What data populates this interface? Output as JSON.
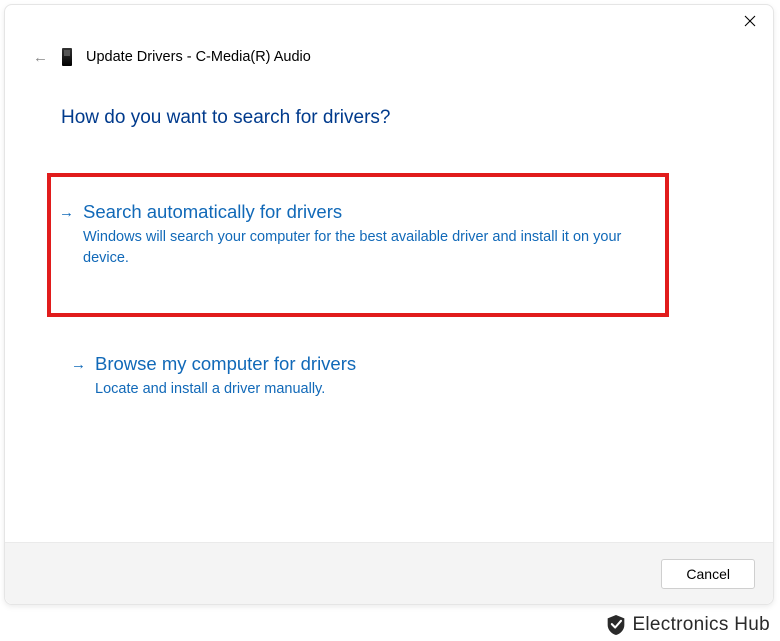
{
  "window": {
    "title": "Update Drivers - C-Media(R) Audio"
  },
  "heading": "How do you want to search for drivers?",
  "options": [
    {
      "title": "Search automatically for drivers",
      "description": "Windows will search your computer for the best available driver and install it on your device."
    },
    {
      "title": "Browse my computer for drivers",
      "description": "Locate and install a driver manually."
    }
  ],
  "buttons": {
    "cancel": "Cancel"
  },
  "watermark": "Electronics Hub"
}
